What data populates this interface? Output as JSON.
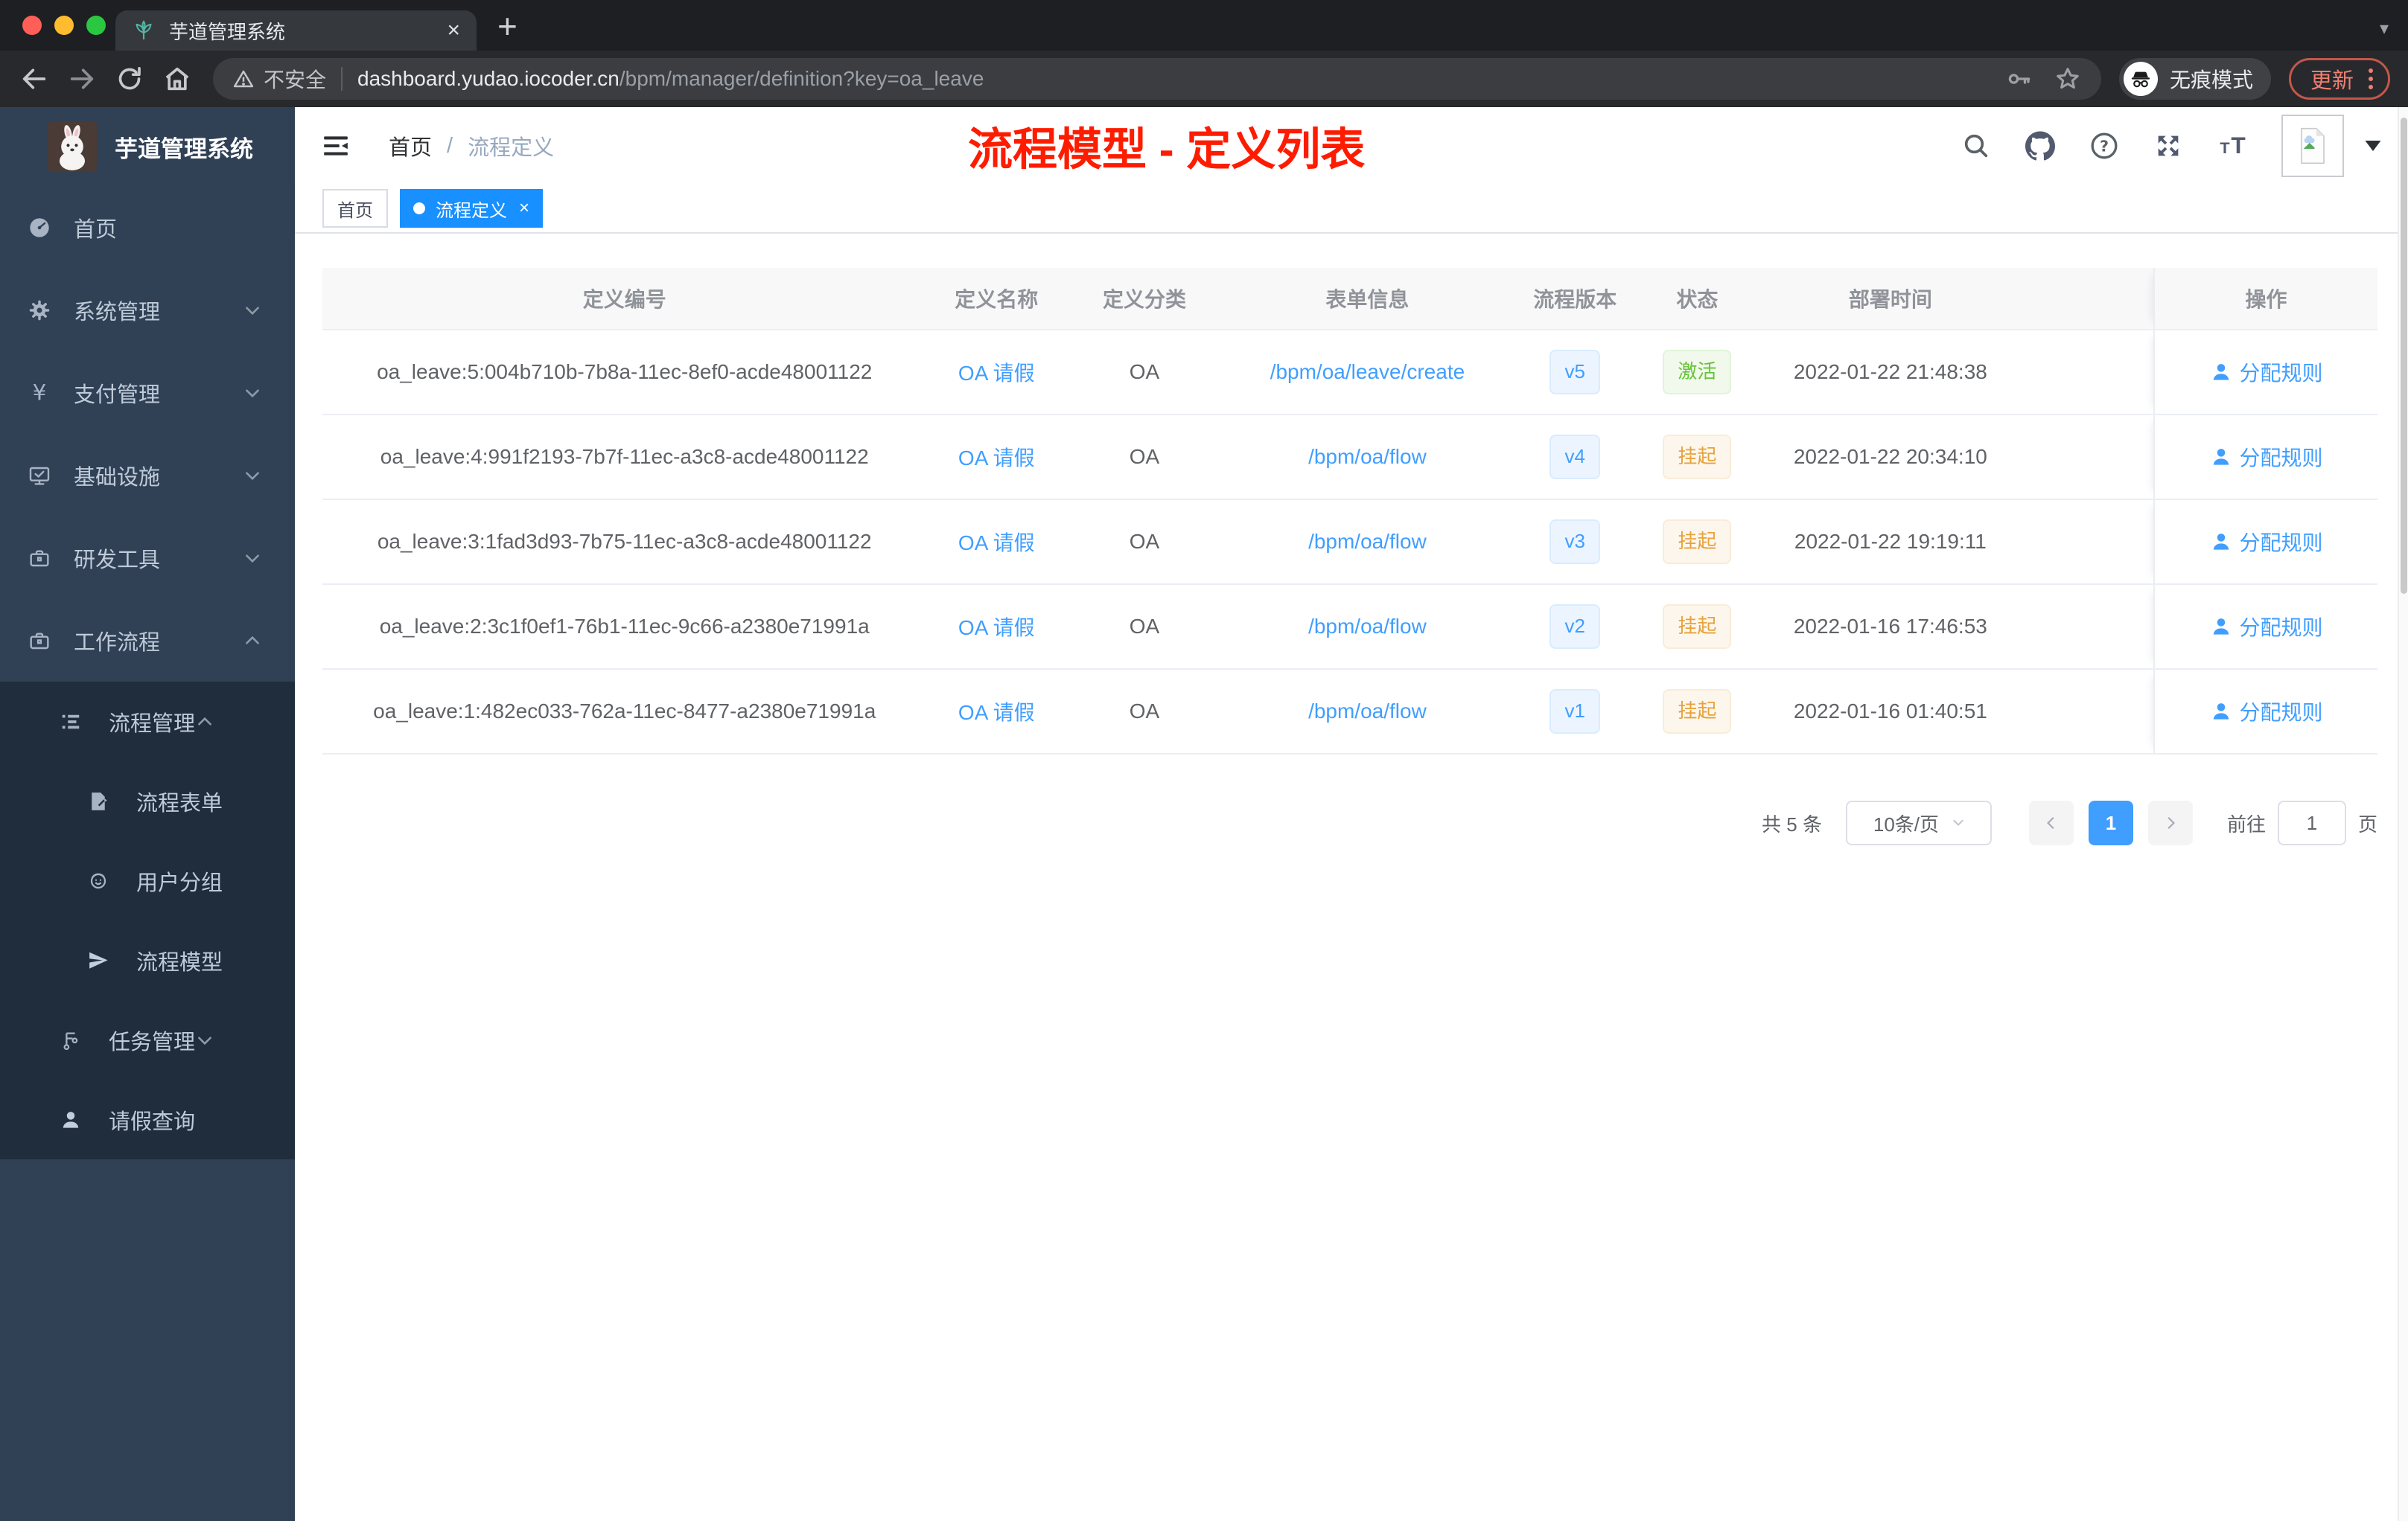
{
  "browser": {
    "tab_title": "芋道管理系统",
    "close_tab": "×",
    "new_tab": "+",
    "security_label": "不安全",
    "url_host": "dashboard.yudao.iocoder.cn",
    "url_path": "/bpm/manager/definition?key=oa_leave",
    "incognito_label": "无痕模式",
    "update_label": "更新"
  },
  "sidebar": {
    "app_title": "芋道管理系统",
    "menu": [
      {
        "label": "首页",
        "icon": "dashboard-icon"
      },
      {
        "label": "系统管理",
        "icon": "gear-icon"
      },
      {
        "label": "支付管理",
        "icon": "yen-icon"
      },
      {
        "label": "基础设施",
        "icon": "monitor-check-icon"
      },
      {
        "label": "研发工具",
        "icon": "briefcase-icon"
      },
      {
        "label": "工作流程",
        "icon": "briefcase-icon"
      }
    ],
    "submenu": [
      {
        "label": "流程管理",
        "icon": "tree-list-icon"
      },
      {
        "label": "流程表单",
        "icon": "form-edit-icon"
      },
      {
        "label": "用户分组",
        "icon": "face-icon"
      },
      {
        "label": "流程模型",
        "icon": "paper-plane-icon"
      },
      {
        "label": "任务管理",
        "icon": "flow-branch-icon"
      },
      {
        "label": "请假查询",
        "icon": "person-icon"
      }
    ]
  },
  "header": {
    "breadcrumb_home": "首页",
    "breadcrumb_sep": "/",
    "breadcrumb_current": "流程定义",
    "annotation_title": "流程模型 - 定义列表"
  },
  "tags": {
    "home": "首页",
    "active": "流程定义",
    "close": "×"
  },
  "table": {
    "columns": [
      "定义编号",
      "定义名称",
      "定义分类",
      "表单信息",
      "流程版本",
      "状态",
      "部署时间",
      "操作"
    ],
    "action_label": "分配规则",
    "rows": [
      {
        "id": "oa_leave:5:004b710b-7b8a-11ec-8ef0-acde48001122",
        "name": "OA 请假",
        "category": "OA",
        "form": "/bpm/oa/leave/create",
        "version": "v5",
        "status": "激活",
        "status_type": "success",
        "deployed": "2022-01-22 21:48:38"
      },
      {
        "id": "oa_leave:4:991f2193-7b7f-11ec-a3c8-acde48001122",
        "name": "OA 请假",
        "category": "OA",
        "form": "/bpm/oa/flow",
        "version": "v4",
        "status": "挂起",
        "status_type": "warning",
        "deployed": "2022-01-22 20:34:10"
      },
      {
        "id": "oa_leave:3:1fad3d93-7b75-11ec-a3c8-acde48001122",
        "name": "OA 请假",
        "category": "OA",
        "form": "/bpm/oa/flow",
        "version": "v3",
        "status": "挂起",
        "status_type": "warning",
        "deployed": "2022-01-22 19:19:11"
      },
      {
        "id": "oa_leave:2:3c1f0ef1-76b1-11ec-9c66-a2380e71991a",
        "name": "OA 请假",
        "category": "OA",
        "form": "/bpm/oa/flow",
        "version": "v2",
        "status": "挂起",
        "status_type": "warning",
        "deployed": "2022-01-16 17:46:53"
      },
      {
        "id": "oa_leave:1:482ec033-762a-11ec-8477-a2380e71991a",
        "name": "OA 请假",
        "category": "OA",
        "form": "/bpm/oa/flow",
        "version": "v1",
        "status": "挂起",
        "status_type": "warning",
        "deployed": "2022-01-16 01:40:51"
      }
    ]
  },
  "pagination": {
    "total": "共 5 条",
    "page_size": "10条/页",
    "page": "1",
    "goto_label": "前往",
    "goto_value": "1",
    "unit_label": "页"
  },
  "colors": {
    "primary": "#409eff",
    "success": "#67c23a",
    "warning": "#e6a23c",
    "tag_active": "#1890ff",
    "annotation_red": "#fe1c00",
    "sidebar_bg": "#304156",
    "submenu_bg": "#1f2d3d"
  }
}
